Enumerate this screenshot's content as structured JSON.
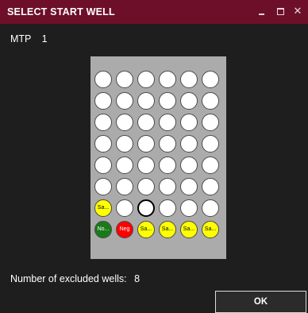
{
  "window": {
    "title": "SELECT START WELL",
    "controls": [
      "minimize-icon",
      "maximize-icon",
      "close-icon"
    ],
    "close_glyph": "✕"
  },
  "mtp": {
    "label": "MTP",
    "value": "1"
  },
  "plate": {
    "columns": 6,
    "rows": 8,
    "selected_well": {
      "row": 7,
      "col": 3
    },
    "labeled_wells": [
      {
        "row": 7,
        "col": 1,
        "label": "Sa...",
        "color": "#ffff00"
      },
      {
        "row": 8,
        "col": 1,
        "label": "No...",
        "color": "#1a7a1a"
      },
      {
        "row": 8,
        "col": 2,
        "label": "Neg",
        "color": "#ff0000"
      },
      {
        "row": 8,
        "col": 3,
        "label": "Sa...",
        "color": "#ffff00"
      },
      {
        "row": 8,
        "col": 4,
        "label": "Sa...",
        "color": "#ffff00"
      },
      {
        "row": 8,
        "col": 5,
        "label": "Sa...",
        "color": "#ffff00"
      },
      {
        "row": 8,
        "col": 6,
        "label": "Sa...",
        "color": "#ffff00"
      }
    ]
  },
  "excluded": {
    "label": "Number of excluded wells:",
    "count": "8"
  },
  "ok_label": "OK",
  "colors": {
    "titlebar": "#6e0f2a",
    "background": "#1e1e1e",
    "plate": "#ababab"
  }
}
